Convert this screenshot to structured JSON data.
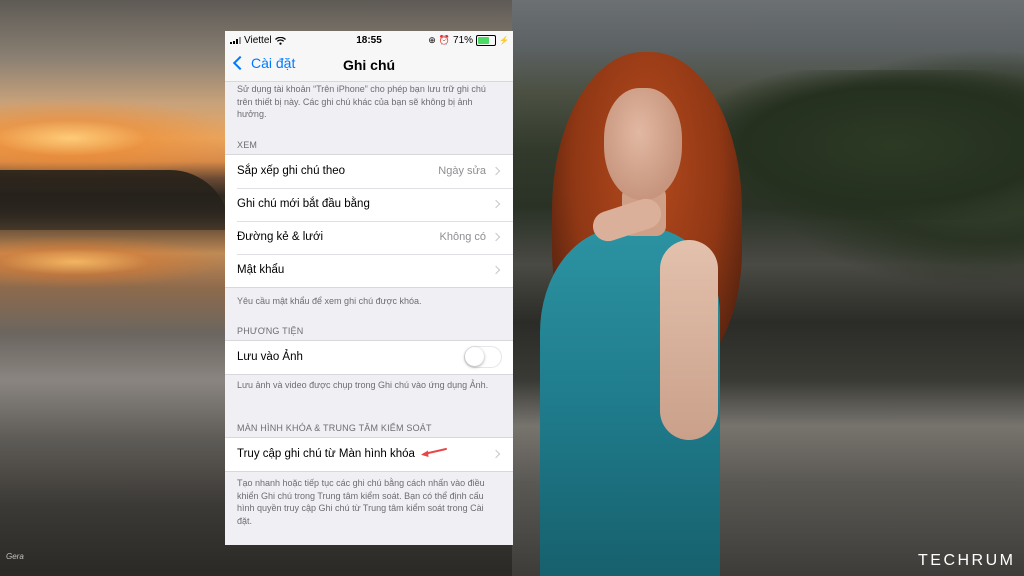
{
  "status_bar": {
    "carrier": "Viettel",
    "time": "18:55",
    "battery_percent": "71%",
    "battery_level": 0.71
  },
  "nav": {
    "back_label": "Cài đặt",
    "title": "Ghi chú"
  },
  "top_note": "Sử dụng tài khoản “Trên iPhone” cho phép bạn lưu trữ ghi chú trên thiết bị này. Các ghi chú khác của bạn sẽ không bị ảnh hưởng.",
  "sections": {
    "xem": {
      "header": "XEM",
      "rows": [
        {
          "label": "Sắp xếp ghi chú theo",
          "value": "Ngày sửa"
        },
        {
          "label": "Ghi chú mới bắt đầu bằng",
          "value": ""
        },
        {
          "label": "Đường kẻ & lưới",
          "value": "Không có"
        },
        {
          "label": "Mật khẩu",
          "value": ""
        }
      ],
      "footer": "Yêu cầu mật khẩu để xem ghi chú được khóa."
    },
    "media": {
      "header": "PHƯƠNG TIỆN",
      "save_to_photos_label": "Lưu vào Ảnh",
      "save_to_photos_on": false,
      "footer": "Lưu ảnh và video được chụp trong Ghi chú vào ứng dụng Ảnh."
    },
    "lock": {
      "header": "MÀN HÌNH KHÓA & TRUNG TÂM KIỂM SOÁT",
      "access_label": "Truy cập ghi chú từ Màn hình khóa",
      "footer": "Tạo nhanh hoặc tiếp tục các ghi chú bằng cách nhấn vào điều khiển Ghi chú trong Trung tâm kiểm soát. Bạn có thể định cấu hình quyền truy cập Ghi chú từ Trung tâm kiểm soát trong Cài đặt."
    }
  },
  "watermark": {
    "brand": "TECHRUM",
    "signature": "Gera"
  },
  "colors": {
    "ios_blue": "#007aff",
    "arrow_red": "#e8474a",
    "dress_teal": "#1f7c8c"
  }
}
